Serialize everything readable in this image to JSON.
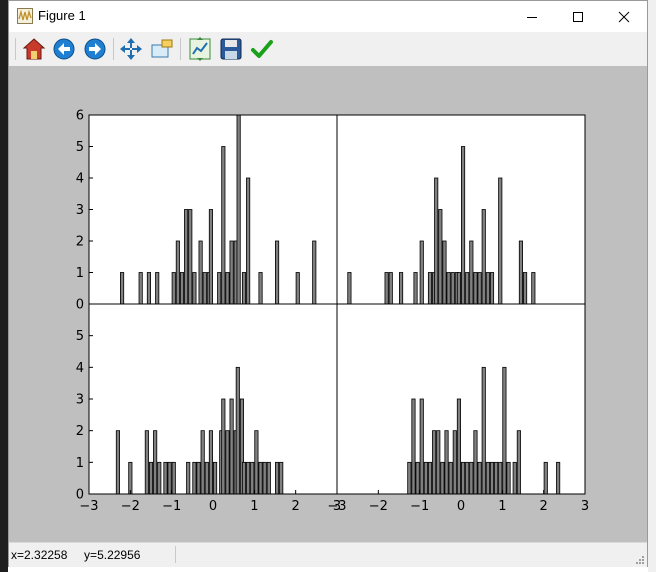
{
  "window": {
    "title": "Figure 1"
  },
  "toolbar": {
    "buttons": [
      {
        "icon": "home-icon"
      },
      {
        "icon": "back-arrow-icon"
      },
      {
        "icon": "forward-arrow-icon"
      },
      {
        "icon": "pan-arrows-icon"
      },
      {
        "icon": "zoom-rectangle-icon"
      },
      {
        "icon": "subplots-config-icon"
      },
      {
        "icon": "save-disk-icon"
      },
      {
        "icon": "checkmark-icon"
      }
    ]
  },
  "statusbar": {
    "coords": "x=2.32258     y=5.22956"
  },
  "colors": {
    "bar_fill": "#808080",
    "bar_edge": "#000000",
    "figure_bg": "#bfbfbf",
    "axes_bg": "#ffffff"
  },
  "chart_data": [
    {
      "type": "bar",
      "position": "top-left",
      "xlim": [
        -3,
        3
      ],
      "ylim": [
        0,
        6
      ],
      "yticks": [
        "0",
        "1",
        "2",
        "3",
        "4",
        "5",
        "6"
      ],
      "xticks": [],
      "bar_width": 0.08,
      "bars": [
        [
          -2.2,
          1
        ],
        [
          -1.75,
          1
        ],
        [
          -1.55,
          1
        ],
        [
          -1.35,
          1
        ],
        [
          -0.95,
          1
        ],
        [
          -0.85,
          2
        ],
        [
          -0.75,
          1
        ],
        [
          -0.65,
          3
        ],
        [
          -0.55,
          3
        ],
        [
          -0.45,
          1
        ],
        [
          -0.3,
          2
        ],
        [
          -0.2,
          1
        ],
        [
          -0.1,
          1
        ],
        [
          -0.05,
          3
        ],
        [
          0.15,
          1
        ],
        [
          0.25,
          5
        ],
        [
          0.35,
          1
        ],
        [
          0.45,
          2
        ],
        [
          0.55,
          2
        ],
        [
          0.62,
          6
        ],
        [
          0.75,
          1
        ],
        [
          0.85,
          4
        ],
        [
          1.15,
          1
        ],
        [
          1.55,
          2
        ],
        [
          2.05,
          1
        ],
        [
          2.45,
          2
        ]
      ]
    },
    {
      "type": "bar",
      "position": "top-right",
      "xlim": [
        -3,
        3
      ],
      "ylim": [
        0,
        6
      ],
      "yticks": [],
      "xticks": [],
      "bar_width": 0.08,
      "bars": [
        [
          -2.7,
          1
        ],
        [
          -1.8,
          1
        ],
        [
          -1.7,
          1
        ],
        [
          -1.45,
          1
        ],
        [
          -1.1,
          1
        ],
        [
          -0.95,
          2
        ],
        [
          -0.75,
          1
        ],
        [
          -0.65,
          1
        ],
        [
          -0.6,
          4
        ],
        [
          -0.5,
          3
        ],
        [
          -0.4,
          2
        ],
        [
          -0.3,
          1
        ],
        [
          -0.2,
          1
        ],
        [
          -0.1,
          1
        ],
        [
          -0.05,
          1
        ],
        [
          0.05,
          5
        ],
        [
          0.15,
          1
        ],
        [
          0.25,
          2
        ],
        [
          0.35,
          1
        ],
        [
          0.45,
          1
        ],
        [
          0.55,
          3
        ],
        [
          0.65,
          1
        ],
        [
          0.75,
          1
        ],
        [
          0.95,
          4
        ],
        [
          1.45,
          2
        ],
        [
          1.55,
          1
        ],
        [
          1.75,
          1
        ]
      ]
    },
    {
      "type": "bar",
      "position": "bottom-left",
      "xlim": [
        -3,
        3
      ],
      "ylim": [
        0,
        6
      ],
      "yticks": [
        "0",
        "1",
        "2",
        "3",
        "4",
        "5"
      ],
      "xticks": [
        "−3",
        "−2",
        "−1",
        "0",
        "1",
        "2",
        "3"
      ],
      "bar_width": 0.08,
      "bars": [
        [
          -2.3,
          2
        ],
        [
          -2.0,
          1
        ],
        [
          -1.6,
          2
        ],
        [
          -1.5,
          1
        ],
        [
          -1.4,
          2
        ],
        [
          -1.3,
          1
        ],
        [
          -1.15,
          1
        ],
        [
          -1.05,
          1
        ],
        [
          -0.95,
          1
        ],
        [
          -0.6,
          1
        ],
        [
          -0.45,
          1
        ],
        [
          -0.35,
          1
        ],
        [
          -0.25,
          2
        ],
        [
          -0.15,
          1
        ],
        [
          -0.05,
          2
        ],
        [
          0.05,
          1
        ],
        [
          0.2,
          2
        ],
        [
          0.25,
          3
        ],
        [
          0.35,
          2
        ],
        [
          0.45,
          3
        ],
        [
          0.55,
          2
        ],
        [
          0.6,
          4
        ],
        [
          0.7,
          3
        ],
        [
          0.75,
          1
        ],
        [
          0.85,
          1
        ],
        [
          0.95,
          1
        ],
        [
          1.05,
          2
        ],
        [
          1.15,
          1
        ],
        [
          1.25,
          1
        ],
        [
          1.35,
          1
        ],
        [
          1.55,
          1
        ],
        [
          1.65,
          1
        ]
      ]
    },
    {
      "type": "bar",
      "position": "bottom-right",
      "xlim": [
        -3,
        3
      ],
      "ylim": [
        0,
        6
      ],
      "yticks": [],
      "xticks": [
        "−3",
        "−2",
        "−1",
        "0",
        "1",
        "2",
        "3"
      ],
      "bar_width": 0.08,
      "bars": [
        [
          -1.25,
          1
        ],
        [
          -1.15,
          3
        ],
        [
          -1.05,
          1
        ],
        [
          -0.95,
          3
        ],
        [
          -0.85,
          1
        ],
        [
          -0.75,
          1
        ],
        [
          -0.65,
          2
        ],
        [
          -0.55,
          2
        ],
        [
          -0.45,
          1
        ],
        [
          -0.35,
          2
        ],
        [
          -0.25,
          1
        ],
        [
          -0.15,
          2
        ],
        [
          -0.05,
          3
        ],
        [
          0.05,
          1
        ],
        [
          0.15,
          1
        ],
        [
          0.25,
          1
        ],
        [
          0.35,
          2
        ],
        [
          0.45,
          1
        ],
        [
          0.55,
          4
        ],
        [
          0.65,
          1
        ],
        [
          0.75,
          1
        ],
        [
          0.85,
          1
        ],
        [
          0.95,
          1
        ],
        [
          1.05,
          4
        ],
        [
          1.15,
          1
        ],
        [
          1.3,
          1
        ],
        [
          1.4,
          2
        ],
        [
          2.05,
          1
        ],
        [
          2.35,
          1
        ]
      ]
    }
  ]
}
